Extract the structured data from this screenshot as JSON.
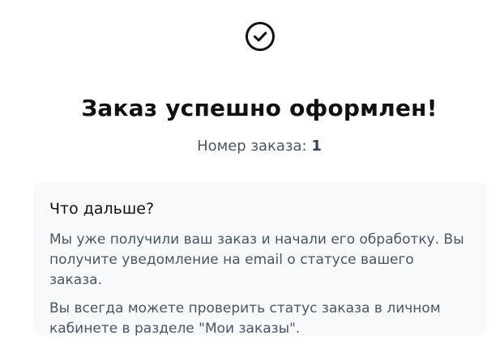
{
  "success": {
    "icon": "check-circle-icon",
    "title": "Заказ успешно оформлен!",
    "order_number_label": "Номер заказа:",
    "order_number_value": "1"
  },
  "next_steps": {
    "title": "Что дальше?",
    "paragraph_1": "Мы уже получили ваш заказ и начали его обработку. Вы получите уведомление на email о статусе вашего заказа.",
    "paragraph_2": "Вы всегда можете проверить статус заказа в личном кабинете в разделе \"Мои заказы\"."
  },
  "colors": {
    "icon_stroke": "#111111",
    "card_background": "#f8f9fa",
    "secondary_text": "#4b5563"
  }
}
